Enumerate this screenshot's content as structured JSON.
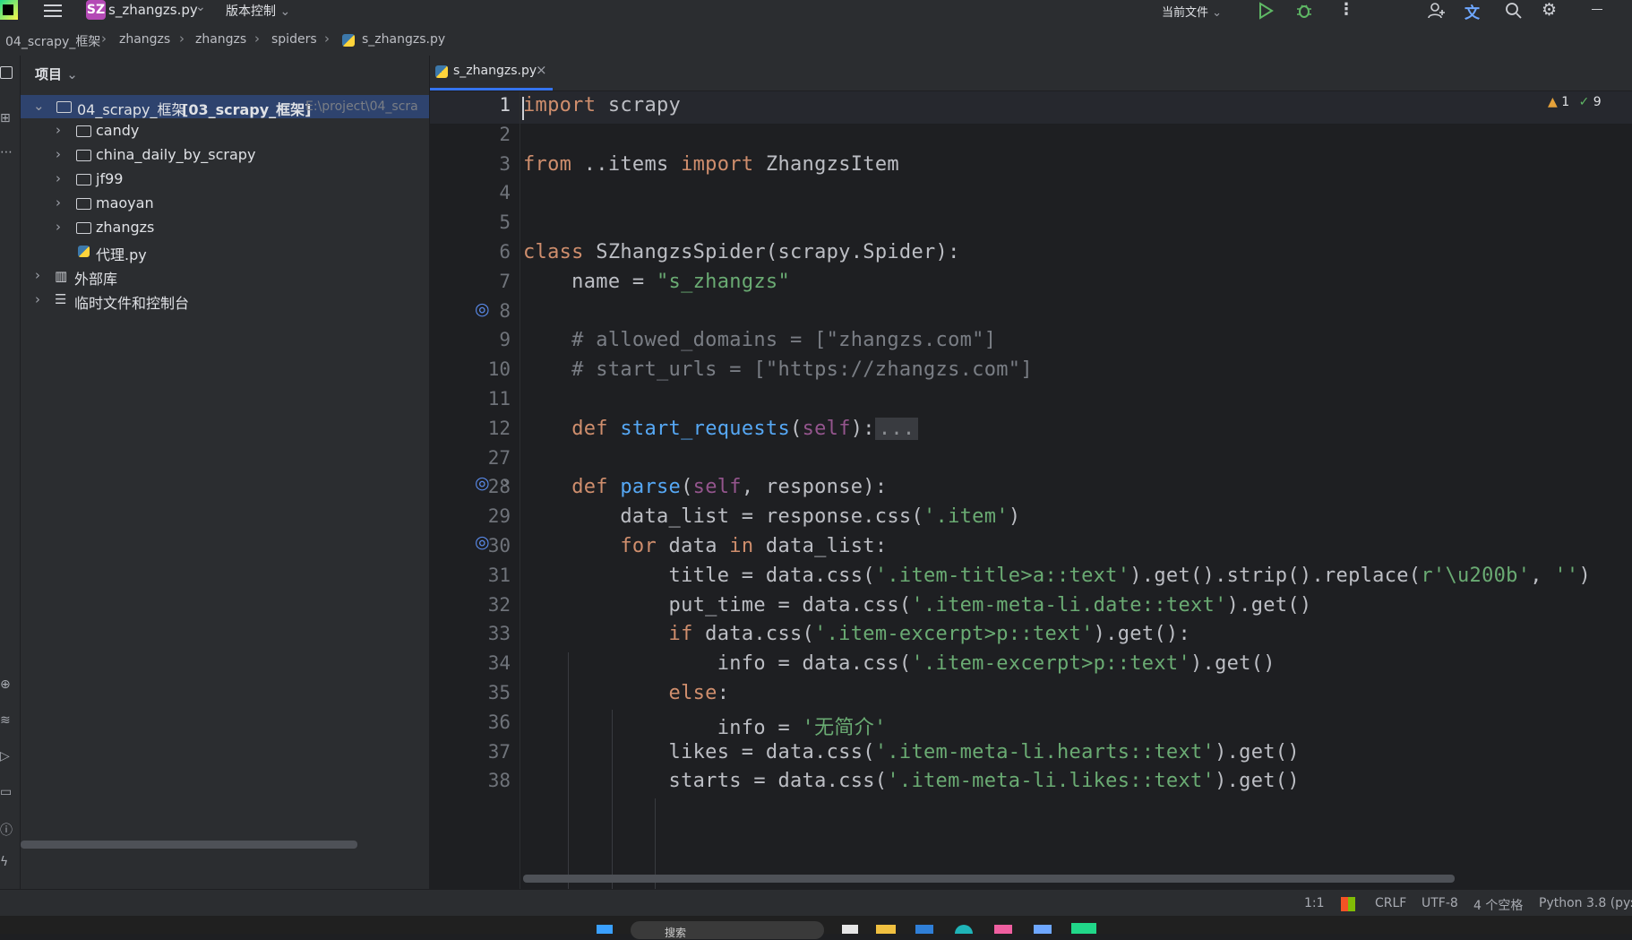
{
  "titlebar": {
    "project_badge": "SZ",
    "file_name": "s_zhangzs.py",
    "vcs_menu": "版本控制",
    "run_config": "当前文件"
  },
  "breadcrumbs": [
    "04_scrapy_框架",
    "zhangzs",
    "zhangzs",
    "spiders",
    "s_zhangzs.py"
  ],
  "project_panel": {
    "title": "项目",
    "root": {
      "name": "04_scrapy_框架",
      "module": "[03_scrapy_框架]",
      "path": "E:\\project\\04_scra"
    },
    "items": [
      {
        "label": "candy",
        "type": "folder"
      },
      {
        "label": "china_daily_by_scrapy",
        "type": "folder"
      },
      {
        "label": "jf99",
        "type": "folder"
      },
      {
        "label": "maoyan",
        "type": "folder"
      },
      {
        "label": "zhangzs",
        "type": "folder"
      },
      {
        "label": "代理.py",
        "type": "python-file"
      }
    ],
    "external": "外部库",
    "scratches": "临时文件和控制台"
  },
  "editor": {
    "tab_label": "s_zhangzs.py",
    "warnings": "1",
    "checks": "9",
    "line_numbers": [
      "1",
      "2",
      "3",
      "4",
      "5",
      "6",
      "7",
      "8",
      "9",
      "10",
      "11",
      "12",
      "27",
      "28",
      "29",
      "30",
      "31",
      "32",
      "33",
      "34",
      "35",
      "36",
      "37",
      "38"
    ],
    "lines": [
      [
        [
          "kw",
          "import"
        ],
        [
          "hl",
          " scrapy"
        ]
      ],
      [],
      [
        [
          "kw",
          "from"
        ],
        [
          "hl",
          " ..items "
        ],
        [
          "kw",
          "import"
        ],
        [
          "hl",
          " ZhangzsItem"
        ]
      ],
      [],
      [],
      [
        [
          "kw",
          "class"
        ],
        [
          "hl",
          " SZhangzsSpider(scrapy.Spider):"
        ]
      ],
      [
        [
          "hl",
          "    name = "
        ],
        [
          "str",
          "\"s_zhangzs\""
        ]
      ],
      [],
      [
        [
          "cm",
          "    # allowed_domains = [\"zhangzs.com\"]"
        ]
      ],
      [
        [
          "cm",
          "    # start_urls = [\"https://zhangzs.com\"]"
        ]
      ],
      [],
      [
        [
          "hl",
          "    "
        ],
        [
          "kw",
          "def"
        ],
        [
          "hl",
          " "
        ],
        [
          "fn",
          "start_requests"
        ],
        [
          "hl",
          "("
        ],
        [
          "slf",
          "self"
        ],
        [
          "hl",
          "):"
        ],
        [
          "cm",
          "..."
        ]
      ],
      [],
      [
        [
          "hl",
          "    "
        ],
        [
          "kw",
          "def"
        ],
        [
          "hl",
          " "
        ],
        [
          "fn",
          "parse"
        ],
        [
          "hl",
          "("
        ],
        [
          "slf",
          "self"
        ],
        [
          "hl",
          ", response):"
        ]
      ],
      [
        [
          "hl",
          "        data_list = response.css("
        ],
        [
          "str",
          "'.item'"
        ],
        [
          "hl",
          ")"
        ]
      ],
      [
        [
          "hl",
          "        "
        ],
        [
          "kw",
          "for"
        ],
        [
          "hl",
          " data "
        ],
        [
          "kw",
          "in"
        ],
        [
          "hl",
          " data_list:"
        ]
      ],
      [
        [
          "hl",
          "            title = data.css("
        ],
        [
          "str",
          "'.item-title>a::text'"
        ],
        [
          "hl",
          ").get().strip().replace("
        ],
        [
          "str",
          "r'\\u200b'"
        ],
        [
          "hl",
          ", "
        ],
        [
          "str",
          "''"
        ],
        [
          "hl",
          ")"
        ]
      ],
      [
        [
          "hl",
          "            put_time = data.css("
        ],
        [
          "str",
          "'.item-meta-li.date::text'"
        ],
        [
          "hl",
          ").get()"
        ]
      ],
      [
        [
          "hl",
          "            "
        ],
        [
          "kw",
          "if"
        ],
        [
          "hl",
          " data.css("
        ],
        [
          "str",
          "'.item-excerpt>p::text'"
        ],
        [
          "hl",
          ").get():"
        ]
      ],
      [
        [
          "hl",
          "                info = data.css("
        ],
        [
          "str",
          "'.item-excerpt>p::text'"
        ],
        [
          "hl",
          ").get()"
        ]
      ],
      [
        [
          "hl",
          "            "
        ],
        [
          "kw",
          "else"
        ],
        [
          "hl",
          ":"
        ]
      ],
      [
        [
          "hl",
          "                info = "
        ],
        [
          "str",
          "'无简介'"
        ]
      ],
      [
        [
          "hl",
          "            likes = data.css("
        ],
        [
          "str",
          "'.item-meta-li.hearts::text'"
        ],
        [
          "hl",
          ").get()"
        ]
      ],
      [
        [
          "hl",
          "            starts = data.css("
        ],
        [
          "str",
          "'.item-meta-li.likes::text'"
        ],
        [
          "hl",
          ").get()"
        ]
      ]
    ]
  },
  "statusbar": {
    "position": "1:1",
    "line_sep": "CRLF",
    "encoding": "UTF-8",
    "indent": "4 个空格",
    "interpreter": "Python 3.8 (py:"
  },
  "taskbar": {
    "search_placeholder": "搜索"
  }
}
